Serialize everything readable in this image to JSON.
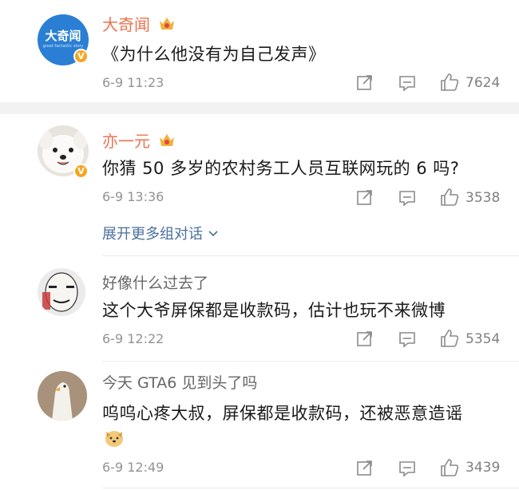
{
  "comments": [
    {
      "author": "大奇闻",
      "avatar_text": "大奇闻",
      "avatar_sub": "great fantastic story",
      "content": "《为什么他没有为自己发声》",
      "time": "6-9 11:23",
      "likes": "7624"
    },
    {
      "author": "亦一元",
      "content": "你猜 50 多岁的农村务工人员互联网玩的 6 吗?",
      "time": "6-9 13:36",
      "likes": "3538",
      "expand_label": "展开更多组对话"
    },
    {
      "author": "好像什么过去了",
      "content": "这个大爷屏保都是收款码，估计也玩不来微博",
      "time": "6-9 12:22",
      "likes": "5354"
    },
    {
      "author": "今天 GTA6 见到头了吗",
      "content": "呜呜心疼大叔，屏保都是收款码，还被恶意造谣",
      "time": "6-9 12:49",
      "likes": "3439"
    }
  ],
  "colors": {
    "name_orange": "#eb7350",
    "link_blue": "#4a6f9d",
    "verified_badge": "#f5a623",
    "avatar_blue": "#2a7fd4"
  },
  "icons": [
    "crown-badge-icon",
    "verified-v-icon",
    "share-icon",
    "comment-icon",
    "like-thumb-icon",
    "chevron-down-icon",
    "dog-emoji-icon"
  ]
}
